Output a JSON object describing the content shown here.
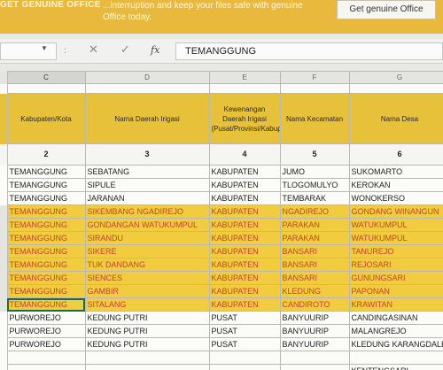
{
  "banner": {
    "title": "GET GENUINE OFFICE",
    "message": "...interruption and keep your files safe with genuine Office today.",
    "button_label": "Get genuine Office"
  },
  "formula_bar": {
    "name_box": "",
    "dropdown_icon": "chevron-down-icon",
    "separator": ":",
    "cancel_icon": "✕",
    "enter_icon": "✓",
    "function_icon": "fx",
    "value": "TEMANGGUNG"
  },
  "columns": [
    "C",
    "D",
    "E",
    "F",
    "G"
  ],
  "header": {
    "kabupaten": "Kabupaten/Kota",
    "daerah_irigasi": "Nama Daerah Irigasi",
    "kewenangan": "Kewenangan Daerah Irigasi (Pusat/Provinsi/Kabupaten)",
    "kecamatan": "Nama Kecamatan",
    "desa": "Nama Desa"
  },
  "numbers": [
    "2",
    "3",
    "4",
    "5",
    "6"
  ],
  "rows": [
    {
      "kab": "TEMANGGUNG",
      "di": "SEBATANG",
      "kw": "KABUPATEN",
      "kec": "JUMO",
      "desa": "SUKOMARTO",
      "hl": false
    },
    {
      "kab": "TEMANGGUNG",
      "di": "SIPULE",
      "kw": "KABUPATEN",
      "kec": "TLOGOMULYO",
      "desa": "KEROKAN",
      "hl": false
    },
    {
      "kab": "TEMANGGUNG",
      "di": "JARANAN",
      "kw": "KABUPATEN",
      "kec": "TEMBARAK",
      "desa": "WONOKERSO",
      "hl": false
    },
    {
      "kab": "TEMANGGUNG",
      "di": "SIKEMBANG NGADIREJO",
      "kw": "KABUPATEN",
      "kec": "NGADIREJO",
      "desa": "GONDANG WINANGUN",
      "hl": true
    },
    {
      "kab": "TEMANGGUNG",
      "di": "GONDANGAN WATUKUMPUL",
      "kw": "KABUPATEN",
      "kec": "PARAKAN",
      "desa": "WATUKUMPUL",
      "hl": true
    },
    {
      "kab": "TEMANGGUNG",
      "di": "SIRANDU",
      "kw": "KABUPATEN",
      "kec": "PARAKAN",
      "desa": "WATUKUMPUL",
      "hl": true
    },
    {
      "kab": "TEMANGGUNG",
      "di": "SIKERE",
      "kw": "KABUPATEN",
      "kec": "BANSARI",
      "desa": "TANUREJO",
      "hl": true
    },
    {
      "kab": "TEMANGGUNG",
      "di": "TUK DANDANG",
      "kw": "KABUPATEN",
      "kec": "BANSARI",
      "desa": "REJOSARI",
      "hl": true
    },
    {
      "kab": "TEMANGGUNG",
      "di": "SIENCES",
      "kw": "KABUPATEN",
      "kec": "BANSARI",
      "desa": "GUNUNGSARI",
      "hl": true
    },
    {
      "kab": "TEMANGGUNG",
      "di": "GAMBIR",
      "kw": "KABUPATEN",
      "kec": "KLEDUNG",
      "desa": "PAPONAN",
      "hl": true
    },
    {
      "kab": "TEMANGGUNG",
      "di": "SITALANG",
      "kw": "KABUPATEN",
      "kec": "CANDIROTO",
      "desa": "KRAWITAN",
      "hl": true
    },
    {
      "kab": "PURWOREJO",
      "di": "KEDUNG PUTRI",
      "kw": "PUSAT",
      "kec": "BANYUURIP",
      "desa": "CANDINGASINAN",
      "hl": false
    },
    {
      "kab": "PURWOREJO",
      "di": "KEDUNG PUTRI",
      "kw": "PUSAT",
      "kec": "BANYUURIP",
      "desa": "MALANGREJO",
      "hl": false
    },
    {
      "kab": "PURWOREJO",
      "di": "KEDUNG PUTRI",
      "kw": "PUSAT",
      "kec": "BANYUURIP",
      "desa": "KLEDUNG KARANGDALEM",
      "hl": false
    },
    {
      "kab": "",
      "di": "",
      "kw": "",
      "kec": "",
      "desa": "",
      "hl": false
    },
    {
      "kab": "",
      "di": "",
      "kw": "",
      "kec": "",
      "desa": "KENTENGSARI",
      "hl": false
    }
  ]
}
